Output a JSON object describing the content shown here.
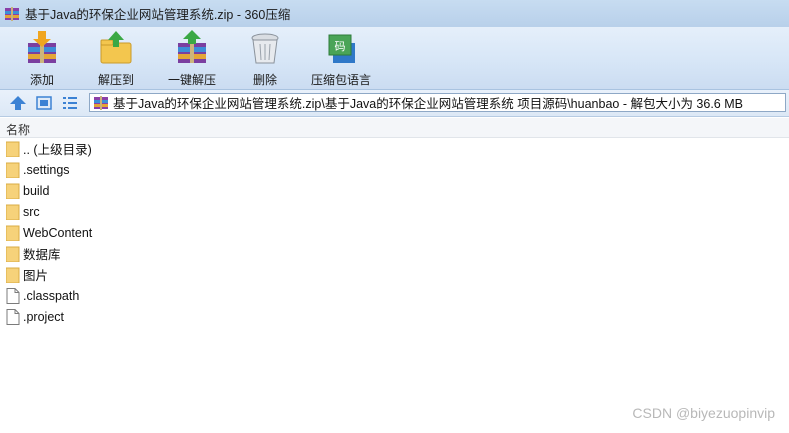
{
  "window": {
    "title": "基于Java的环保企业网站管理系统.zip - 360压缩"
  },
  "toolbar": {
    "items": [
      {
        "label": "添加",
        "icon": "add-archive-icon"
      },
      {
        "label": "解压到",
        "icon": "extract-to-folder-icon"
      },
      {
        "label": "一键解压",
        "icon": "quick-extract-icon"
      },
      {
        "label": "删除",
        "icon": "trash-can-icon"
      },
      {
        "label": "压缩包语言",
        "icon": "archive-language-icon"
      }
    ]
  },
  "address": {
    "path": "基于Java的环保企业网站管理系统.zip\\基于Java的环保企业网站管理系统 项目源码\\huanbao - 解包大小为 36.6 MB"
  },
  "list": {
    "column_name": "名称",
    "items": [
      {
        "name": ".. (上级目录)",
        "type": "folder"
      },
      {
        "name": ".settings",
        "type": "folder"
      },
      {
        "name": "build",
        "type": "folder"
      },
      {
        "name": "src",
        "type": "folder"
      },
      {
        "name": "WebContent",
        "type": "folder"
      },
      {
        "name": "数据库",
        "type": "folder"
      },
      {
        "name": "图片",
        "type": "folder"
      },
      {
        "name": ".classpath",
        "type": "file"
      },
      {
        "name": ".project",
        "type": "file"
      }
    ]
  },
  "watermark": "CSDN @biyezuopinvip",
  "colors": {
    "toolbar_bg": "#d7e6f7",
    "folder": "#f6d27a",
    "accent": "#3c82d4"
  }
}
